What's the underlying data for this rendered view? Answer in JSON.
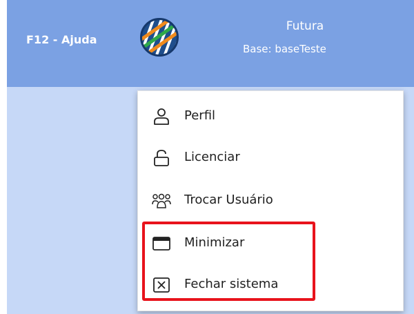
{
  "header": {
    "help_label": "F12 - Ajuda",
    "app_name": "Futura",
    "base_text": "Base: baseTeste",
    "logo_icon": "futura-logo-icon",
    "background_color": "#7ba1e3"
  },
  "content": {
    "background_color": "#c6d8f7"
  },
  "menu": {
    "items": [
      {
        "label": "Perfil",
        "icon": "user-icon"
      },
      {
        "label": "Licenciar",
        "icon": "unlock-icon"
      },
      {
        "label": "Trocar Usuário",
        "icon": "users-group-icon"
      },
      {
        "label": "Minimizar",
        "icon": "window-minimize-icon"
      },
      {
        "label": "Fechar sistema",
        "icon": "close-box-icon"
      }
    ],
    "highlight_color": "#e8131c"
  }
}
